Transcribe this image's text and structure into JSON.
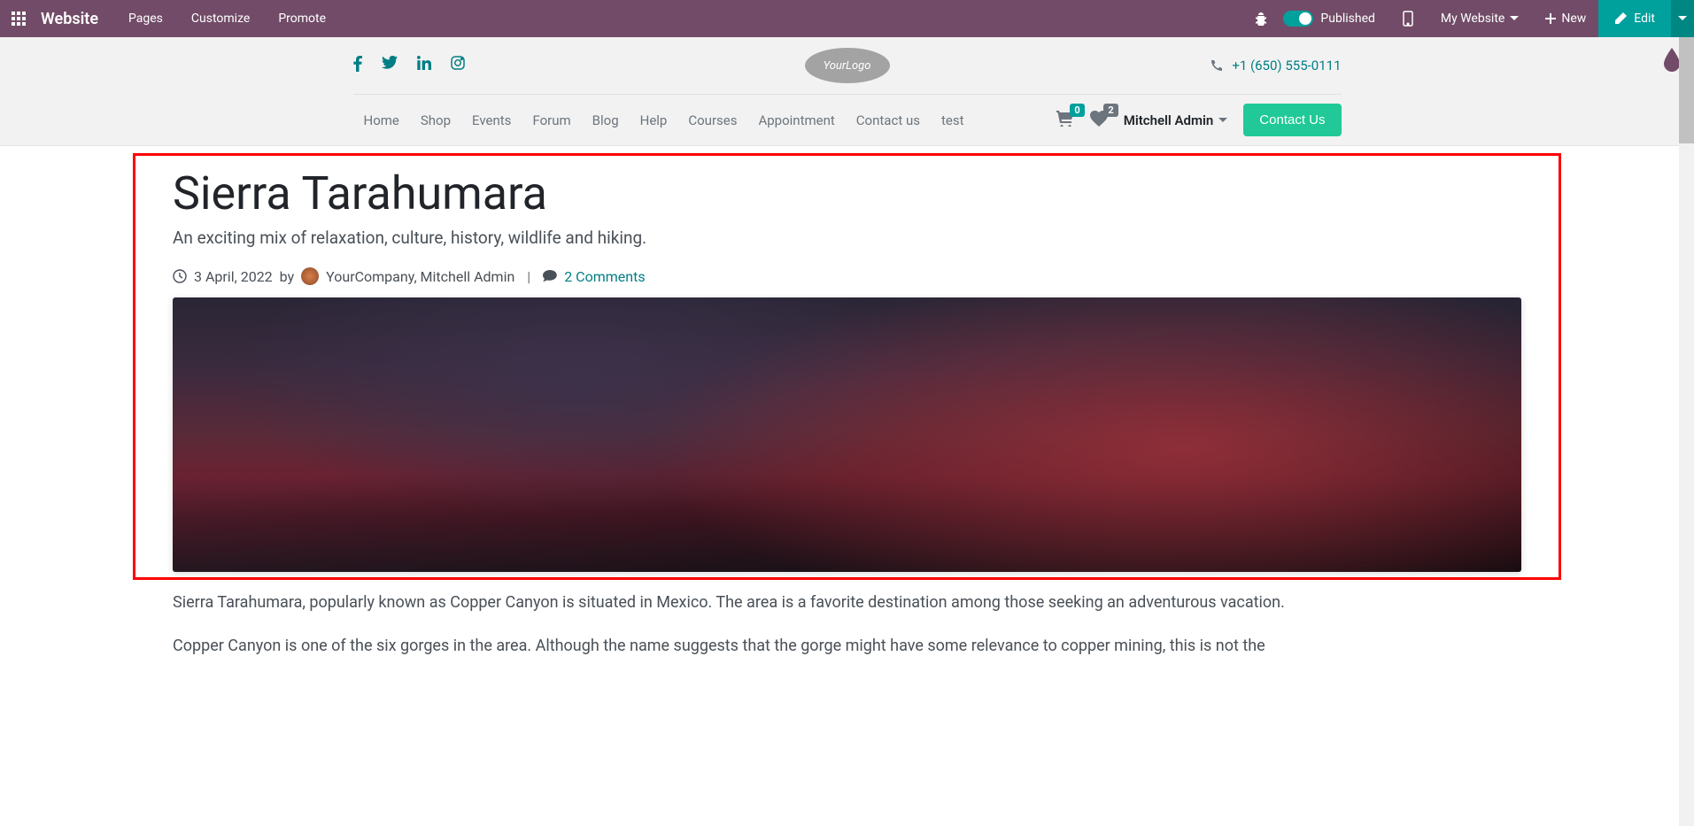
{
  "admin": {
    "brand": "Website",
    "menu": [
      "Pages",
      "Customize",
      "Promote"
    ],
    "published": "Published",
    "my_website": "My Website",
    "new": "New",
    "edit": "Edit"
  },
  "header": {
    "phone": "+1 (650) 555-0111",
    "logo_text": "YourLogo",
    "nav": [
      "Home",
      "Shop",
      "Events",
      "Forum",
      "Blog",
      "Help",
      "Courses",
      "Appointment",
      "Contact us",
      "test"
    ],
    "cart_count": "0",
    "wishlist_count": "2",
    "user": "Mitchell Admin",
    "contact_btn": "Contact Us"
  },
  "article": {
    "title": "Sierra Tarahumara",
    "subtitle": "An exciting mix of relaxation, culture, history, wildlife and hiking.",
    "date": "3 April, 2022",
    "by": "by",
    "author": "YourCompany, Mitchell Admin",
    "comments": "2 Comments",
    "body1": "Sierra Tarahumara, popularly known as Copper Canyon is situated in Mexico. The area is a favorite destination among those seeking an adventurous vacation.",
    "body2": "Copper Canyon is one of the six gorges in the area. Although the name suggests that the gorge might have some relevance to copper mining, this is not the"
  }
}
